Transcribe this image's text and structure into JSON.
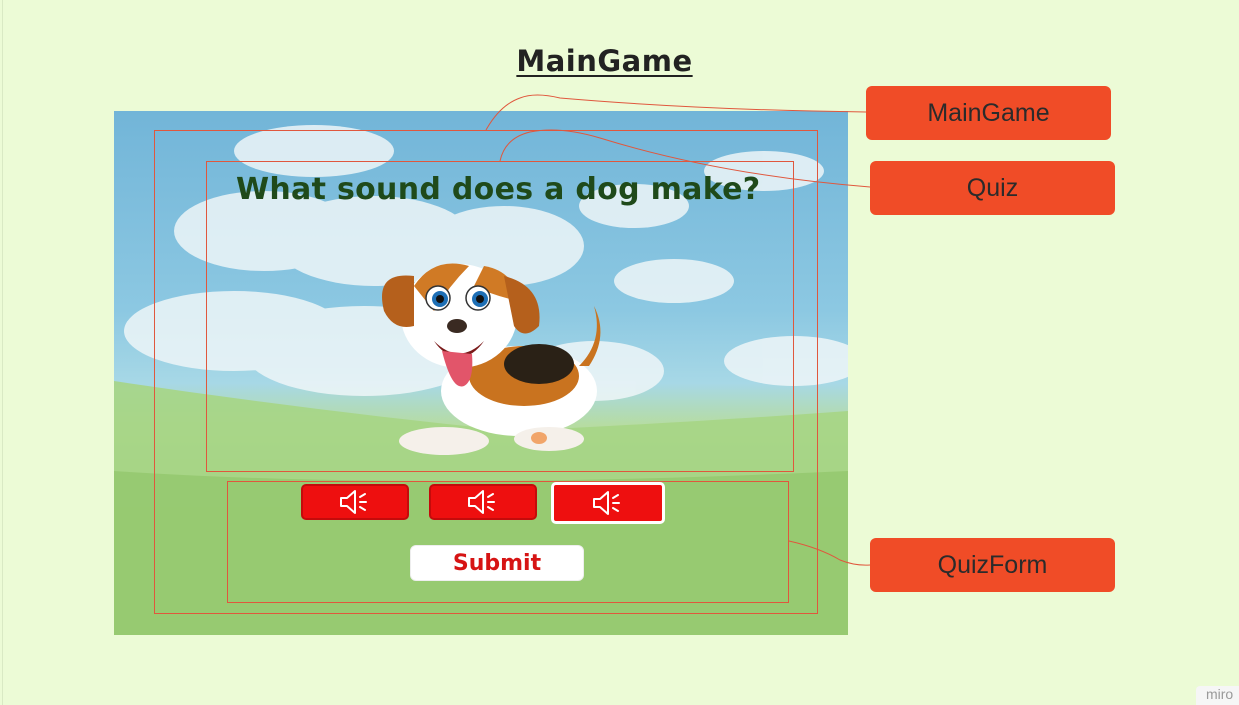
{
  "diagram": {
    "title": "MainGame",
    "labels": {
      "main_game": "MainGame",
      "quiz": "Quiz",
      "quiz_form": "QuizForm"
    },
    "colors": {
      "background": "#ecfbd6",
      "label_fill": "#f04c27",
      "frame_outline": "#e0573d"
    }
  },
  "game": {
    "question": "What sound does a dog make?",
    "illustration": "beagle-puppy",
    "sound_buttons": [
      {
        "icon": "speaker-icon",
        "selected": false
      },
      {
        "icon": "speaker-icon",
        "selected": false
      },
      {
        "icon": "speaker-icon",
        "selected": true
      }
    ],
    "submit_label": "Submit",
    "colors": {
      "sound_button": "#ee0f0f",
      "question_text": "#1f4a1a",
      "submit_text": "#d61414"
    }
  },
  "brand": "miro"
}
